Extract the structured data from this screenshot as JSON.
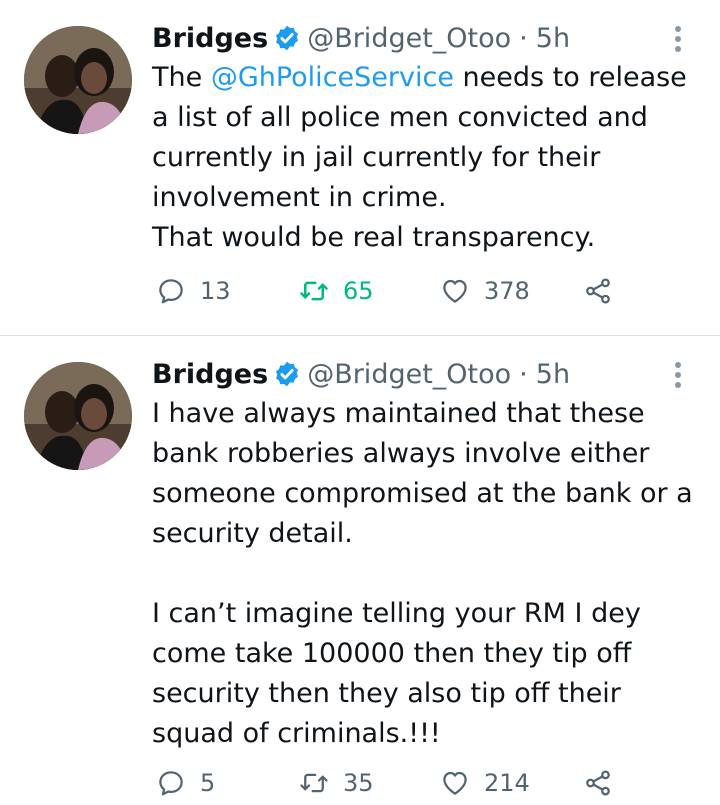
{
  "tweets": [
    {
      "author_name": "Bridges",
      "handle": "@Bridget_Otoo",
      "separator": "·",
      "time": "5h",
      "text_prefix": "The ",
      "mention": "@GhPoliceService",
      "text_rest": " needs to release\na list of all police men convicted and\ncurrently in jail currently for their\ninvolvement in crime.\nThat would be real transparency.",
      "replies": "13",
      "retweets": "65",
      "likes": "378",
      "retweet_color": "#00ba7c"
    },
    {
      "author_name": "Bridges",
      "handle": "@Bridget_Otoo",
      "separator": "·",
      "time": "5h",
      "text": "I have always maintained that these\nbank robberies always involve either\nsomeone compromised at the bank or a\nsecurity detail.\n\nI can’t imagine telling your RM I dey\ncome take 100000 then they tip off\nsecurity then they also tip off their\nsquad of criminals.!!!",
      "replies": "5",
      "retweets": "35",
      "likes": "214"
    }
  ],
  "colors": {
    "text": "#0f1419",
    "secondary": "#536471",
    "link": "#1d9bf0",
    "verified_badge": "#1d9bf0",
    "retweeted": "#00ba7c",
    "divider": "#dfe4e8"
  },
  "icons": {
    "reply": "reply-icon",
    "retweet": "retweet-icon",
    "like": "heart-icon",
    "share": "share-icon",
    "more": "more-options-icon",
    "verified": "verified-badge-icon"
  }
}
